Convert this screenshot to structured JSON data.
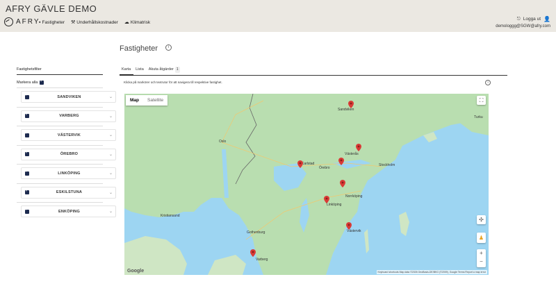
{
  "app": {
    "title": "AFRY GÄVLE DEMO",
    "logo_text": "AFRY"
  },
  "nav": [
    {
      "label": "Fastigheter",
      "icon": "building-icon"
    },
    {
      "label": "Underhållskostnader",
      "icon": "hammer-icon"
    },
    {
      "label": "Klimatrisk",
      "icon": "cloud-icon"
    }
  ],
  "user": {
    "logout_label": "Logga ut",
    "email": "demologgg@SGW@afry.com"
  },
  "page": {
    "title": "Fastigheter"
  },
  "filter": {
    "tab_label": "Fastighetsfilter",
    "mark_all_label": "Markera alla",
    "cities": [
      "SANDVIKEN",
      "VARBERG",
      "VÄSTERVIK",
      "ÖREBRO",
      "LINKÖPING",
      "ESKILSTUNA",
      "ENKÖPING"
    ]
  },
  "tabs": [
    {
      "label": "Karta",
      "active": true
    },
    {
      "label": "Lista"
    },
    {
      "label": "Akuta åtgärder",
      "badge": "1"
    }
  ],
  "hint": "Klicka på markörer och textrutor för att navigera till respektive fastighet.",
  "map": {
    "type_map": "Map",
    "type_satellite": "Satellite",
    "google_label": "Google",
    "attribution": "Keyboard shortcuts   Map data ©2026 GeoBasis-DE/BKG (©2009), Google   Terms   Report a map error",
    "cities": [
      "Oslo",
      "Stockholm",
      "Turku",
      "Gothenburg",
      "Kristiansand",
      "Örebro",
      "Sandviken",
      "Västerås",
      "Linköping",
      "Norrköping",
      "Västervik",
      "Varberg",
      "Karlstad"
    ],
    "marker_color": "#d93a36"
  }
}
